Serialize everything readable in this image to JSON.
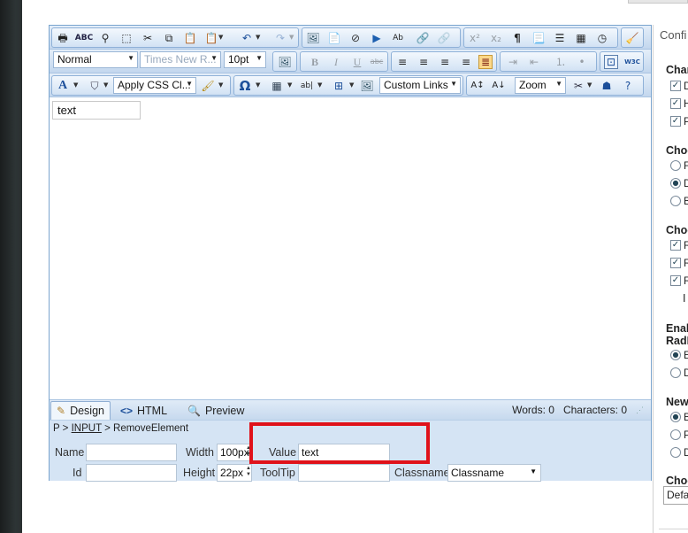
{
  "toolbar": {
    "paragraph_style": "Normal",
    "font_name": "Times New R...",
    "font_size": "10pt",
    "css_class": "Apply CSS Cl...",
    "custom_links": "Custom Links",
    "zoom": "Zoom",
    "symbol": "Ω",
    "icons_row1": [
      "print-icon",
      "spellcheck-icon",
      "find-icon",
      "select-all-icon",
      "cut-icon",
      "copy-icon",
      "paste-icon",
      "paste-options-icon",
      "undo-icon",
      "redo-icon",
      "image-manager-icon",
      "document-manager-icon",
      "flash-manager-icon",
      "media-manager-icon",
      "template-manager-icon",
      "hyperlink-icon",
      "remove-link-icon",
      "superscript-icon",
      "subscript-icon",
      "paragraph-marks-icon",
      "new-paragraph-icon",
      "insert-hr-icon",
      "insert-date-icon",
      "insert-time-icon",
      "format-stripper-icon"
    ],
    "w3c_label": "W3C"
  },
  "content": {
    "text_field_value": "text"
  },
  "modes": {
    "design": "Design",
    "html": "HTML",
    "preview": "Preview",
    "words_label": "Words:",
    "words_value": "0",
    "chars_label": "Characters:",
    "chars_value": "0"
  },
  "breadcrumb": {
    "root": "P",
    "sep1": ">",
    "input": "INPUT",
    "sep2": ">",
    "action": "RemoveElement"
  },
  "properties": {
    "name_label": "Name",
    "name_value": "",
    "id_label": "Id",
    "id_value": "",
    "width_label": "Width",
    "width_value": "100px",
    "height_label": "Height",
    "height_value": "22px",
    "value_label": "Value",
    "value_value": "text",
    "tooltip_label": "ToolTip",
    "tooltip_value": "",
    "classname_label": "Classname",
    "classname_value": "Classname"
  },
  "right_panel": {
    "title": "Confi",
    "sec1": "Char",
    "sec1_items": [
      "D",
      "H",
      "P"
    ],
    "sec2": "Choo",
    "sec2_items": [
      "F",
      "D",
      "B"
    ],
    "sec3": "Choo",
    "sec3_items": [
      "R",
      "R",
      "R"
    ],
    "sec3_note": "I",
    "sec4_line1": "Enab",
    "sec4_line2": "RadE",
    "sec4_items": [
      "E",
      "D"
    ],
    "sec5": "New",
    "sec5_items": [
      "B",
      "P",
      "D"
    ],
    "sec6": "Choo",
    "sec6_select": "Defa"
  },
  "colors": {
    "highlight": "#e0121a",
    "toolbar_blue": "#c3d7ee",
    "border_blue": "#7aa4ce"
  }
}
